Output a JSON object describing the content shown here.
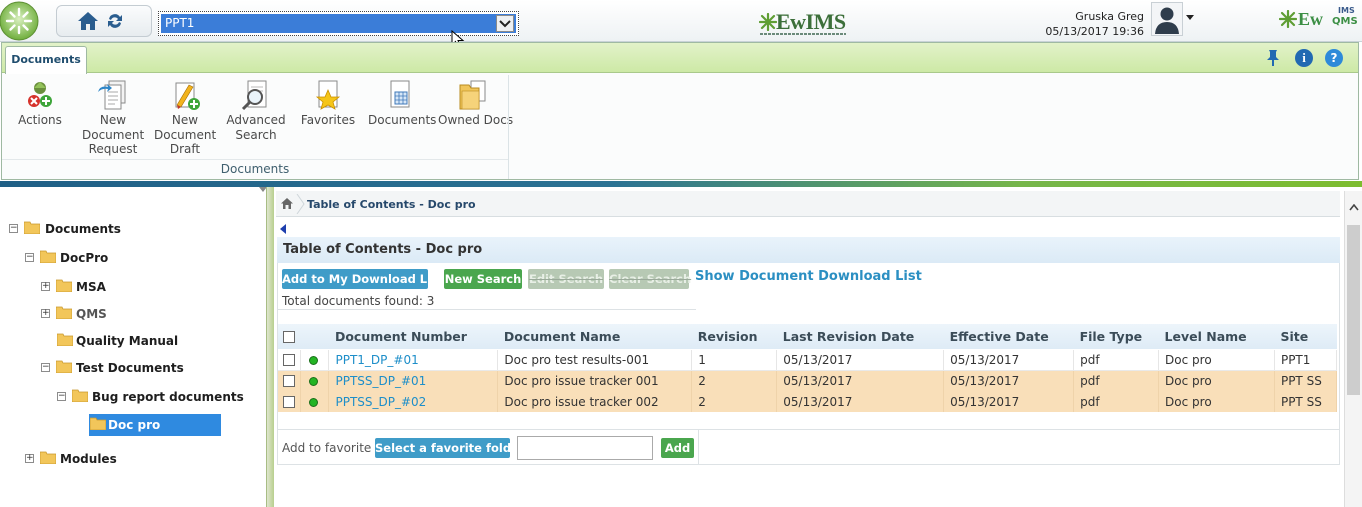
{
  "header": {
    "site_value": "PPT1",
    "center_logo": "EwIMS",
    "user_name": "Gruska Greg",
    "datetime": "05/13/2017 19:36",
    "right_logo_ew": "Ew",
    "right_logo_ims": "IMS",
    "right_logo_qms": "QMS"
  },
  "ribbon": {
    "tab": "Documents",
    "group_label": "Documents",
    "buttons": [
      {
        "label": "Actions"
      },
      {
        "label": "New\nDocument\nRequest"
      },
      {
        "label": "New\nDocument\nDraft"
      },
      {
        "label": "Advanced\nSearch"
      },
      {
        "label": "Favorites"
      },
      {
        "label": "Documents"
      },
      {
        "label": "Owned Docs"
      }
    ],
    "info_glyph": "i",
    "help_glyph": "?"
  },
  "tree": {
    "nodes": [
      {
        "label": "Documents",
        "expander": "−"
      },
      {
        "label": "DocPro",
        "expander": "−"
      },
      {
        "label": "MSA",
        "expander": "+"
      },
      {
        "label": "QMS",
        "expander": "+"
      },
      {
        "label": "Quality Manual",
        "expander": ""
      },
      {
        "label": "Test Documents",
        "expander": "−"
      },
      {
        "label": "Bug report documents",
        "expander": "−"
      },
      {
        "label": "Doc pro",
        "expander": ""
      },
      {
        "label": "Modules",
        "expander": "+"
      }
    ]
  },
  "main": {
    "breadcrumb": "Table of Contents - Doc pro",
    "title": "Table of Contents - Doc pro",
    "buttons": {
      "add_download": "Add to My Download List",
      "new_search": "New Search",
      "edit_search": "Edit Search",
      "clear_search": "Clear Search"
    },
    "show_download_link": "Show Document Download List",
    "total": "Total documents found: 3",
    "columns": [
      "Document Number",
      "Document Name",
      "Revision",
      "Last Revision Date",
      "Effective Date",
      "File Type",
      "Level Name",
      "Site"
    ],
    "rows": [
      [
        "PPT1_DP_#01",
        "Doc pro test results-001",
        "1",
        "05/13/2017",
        "05/13/2017",
        "pdf",
        "Doc pro",
        "PPT1"
      ],
      [
        "PPTSS_DP_#01",
        "Doc pro issue tracker 001",
        "2",
        "05/13/2017",
        "05/13/2017",
        "pdf",
        "Doc pro",
        "PPT SS"
      ],
      [
        "PPTSS_DP_#02",
        "Doc pro issue tracker 002",
        "2",
        "05/13/2017",
        "05/13/2017",
        "pdf",
        "Doc pro",
        "PPT SS"
      ]
    ],
    "favorite": {
      "label": "Add to favorite",
      "select_button": "Select a favorite folder",
      "input_value": "",
      "add_button": "Add"
    }
  }
}
